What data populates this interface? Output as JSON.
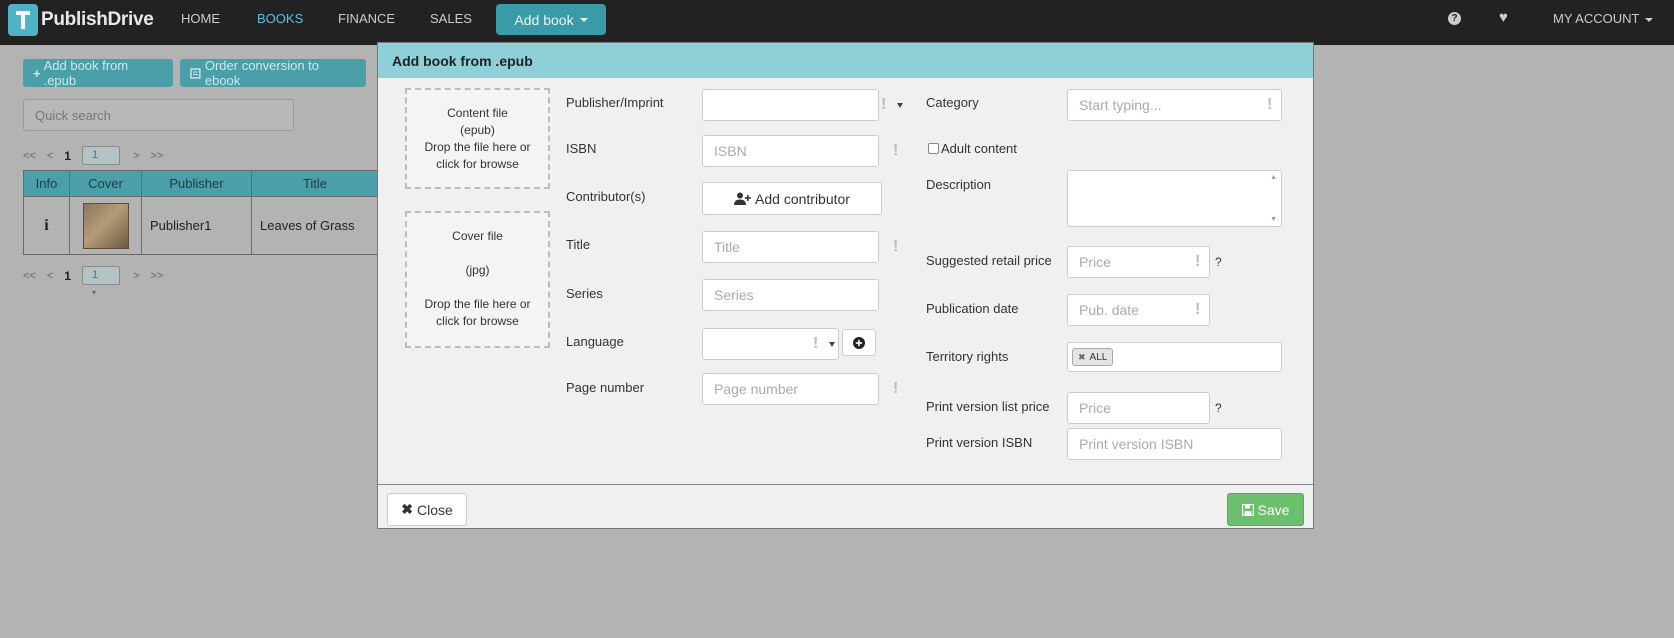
{
  "navbar": {
    "brand": "PublishDrive",
    "links": [
      {
        "label": "HOME",
        "active": false
      },
      {
        "label": "BOOKS",
        "active": true
      },
      {
        "label": "FINANCE",
        "active": false
      },
      {
        "label": "SALES",
        "active": false
      }
    ],
    "add_book": "Add book",
    "help_glyph": "?",
    "heart_glyph": "♥",
    "account": "MY ACCOUNT"
  },
  "page": {
    "add_from_epub": "Add book from .epub",
    "order_conversion": "Order conversion to ebook",
    "quick_search_placeholder": "Quick search",
    "pager": {
      "first": "<<",
      "prev": "<",
      "current": "1",
      "select": "1",
      "next": ">",
      "last": ">>"
    },
    "table": {
      "headers": [
        "Info",
        "Cover",
        "Publisher",
        "Title"
      ],
      "rows": [
        {
          "info": "i",
          "publisher": "Publisher1",
          "title": "Leaves of Grass"
        }
      ]
    }
  },
  "modal": {
    "title": "Add book from .epub",
    "content_file": {
      "line1": "Content file",
      "line2": "(epub)",
      "line3": "Drop the file here or",
      "line4": "click for browse"
    },
    "cover_file": {
      "line1": "Cover file",
      "line2": "(jpg)",
      "line3": "Drop the file here or",
      "line4": "click for browse"
    },
    "fields": {
      "publisher": {
        "label": "Publisher/Imprint",
        "value": ""
      },
      "isbn": {
        "label": "ISBN",
        "placeholder": "ISBN"
      },
      "contributors": {
        "label": "Contributor(s)",
        "button": "Add contributor"
      },
      "title": {
        "label": "Title",
        "placeholder": "Title"
      },
      "series": {
        "label": "Series",
        "placeholder": "Series"
      },
      "language": {
        "label": "Language",
        "value": ""
      },
      "page_number": {
        "label": "Page number",
        "placeholder": "Page number"
      },
      "category": {
        "label": "Category",
        "placeholder": "Start typing..."
      },
      "adult": {
        "label": "Adult content",
        "checked": false
      },
      "description": {
        "label": "Description",
        "value": ""
      },
      "retail_price": {
        "label": "Suggested retail price",
        "placeholder": "Price",
        "help": "?"
      },
      "pub_date": {
        "label": "Publication date",
        "placeholder": "Pub. date"
      },
      "territory": {
        "label": "Territory rights",
        "tags": [
          "ALL"
        ]
      },
      "print_price": {
        "label": "Print version list price",
        "placeholder": "Price",
        "help": "?"
      },
      "print_isbn": {
        "label": "Print version ISBN",
        "placeholder": "Print version ISBN"
      }
    },
    "close": "Close",
    "save": "Save",
    "required_mark": "!"
  }
}
